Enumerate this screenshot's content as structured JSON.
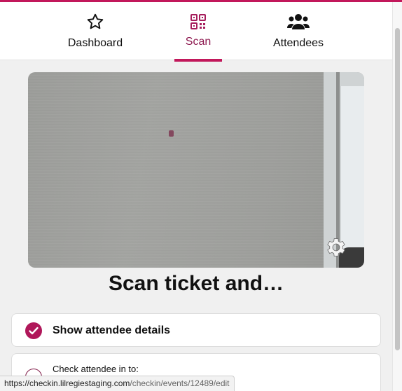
{
  "tabs": [
    {
      "label": "Dashboard",
      "icon": "star-icon",
      "active": false
    },
    {
      "label": "Scan",
      "icon": "qr-code-icon",
      "active": true
    },
    {
      "label": "Attendees",
      "icon": "people-icon",
      "active": false
    }
  ],
  "colors": {
    "accent": "#c2185b",
    "accent_dark": "#8e1b51",
    "background": "#f0f0f0"
  },
  "camera": {
    "settings_icon": "gear-icon"
  },
  "main": {
    "heading": "Scan ticket and…"
  },
  "options": [
    {
      "label": "Show attendee details",
      "checked": true
    },
    {
      "label": "Check attendee in to:",
      "checked": false
    }
  ],
  "status_bar": {
    "url_host": "https://checkin.lilregiestaging.com",
    "url_path": "/checkin/events/12489/edit"
  }
}
